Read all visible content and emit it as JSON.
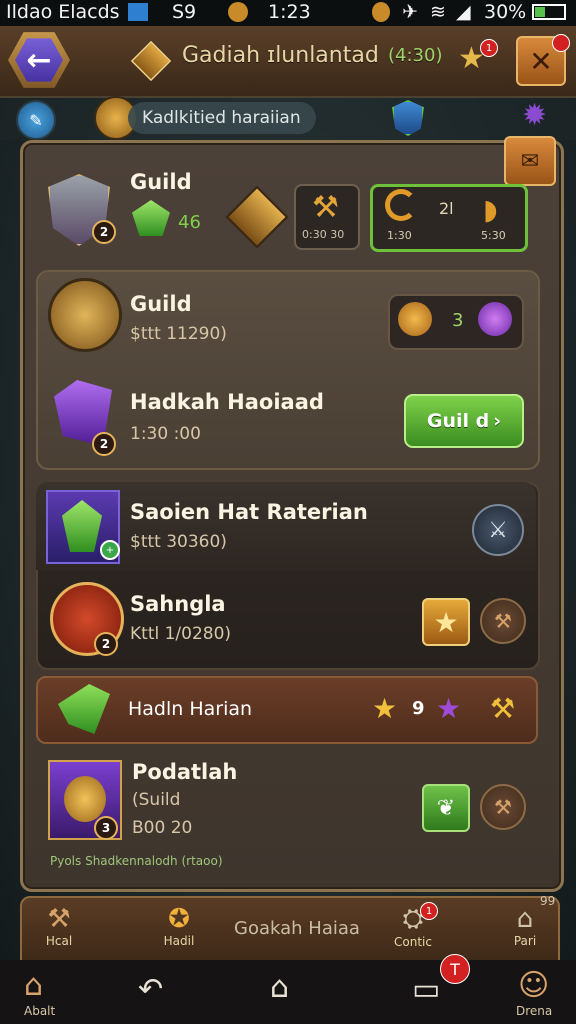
{
  "status_bar": {
    "carrier": "Ildao Elacds",
    "signal_text": "S9",
    "time": "1:23",
    "battery": "30%"
  },
  "header": {
    "title": "Gadiah ɪlunlantad",
    "title_count": "(4:30)",
    "back_icon": "back-arrow-icon",
    "close_icon": "close-icon",
    "star_badge": "1"
  },
  "subbar": {
    "pill_label": "Kadlkitied haraiian"
  },
  "top_row": {
    "name": "Guild",
    "gem_value": "46",
    "box1": "0:30 30",
    "box2_count": "2l",
    "box2_left": "1:30",
    "box2_right": "5:30"
  },
  "cards": [
    {
      "name": "Guild",
      "detail": "$ttt 11290)",
      "res_count": "3"
    },
    {
      "name": "Hadkah Haoiaad",
      "detail": "1:30 :00",
      "badge": "2",
      "button": "Guil d"
    },
    {
      "name": "Saoien Hat Raterian",
      "detail": "$ttt 30360)"
    },
    {
      "name": "Sahngla",
      "detail": "Kttl 1/0280)",
      "badge": "2"
    }
  ],
  "section": {
    "label": "Hadln Harian",
    "count": "9"
  },
  "last_item": {
    "name": "Podatlah",
    "line2": "(Suild",
    "line3": "B00 20",
    "footer": "Pyols Shadkennalodh (rtaoo)"
  },
  "tabs": [
    {
      "label": "Hcal"
    },
    {
      "label": "Hadil"
    },
    {
      "label": "Goakah Haiaa"
    },
    {
      "label": "Contic",
      "badge": "1"
    },
    {
      "label": "Pari"
    }
  ],
  "tab_side_badge": "99",
  "navbar": {
    "left_label": "Abalt",
    "right_label": "Drena",
    "badge": "T"
  },
  "colors": {
    "accent_gold": "#e6b25a",
    "green": "#5fbf34",
    "purple": "#7a3fd0",
    "red_badge": "#d32121"
  }
}
